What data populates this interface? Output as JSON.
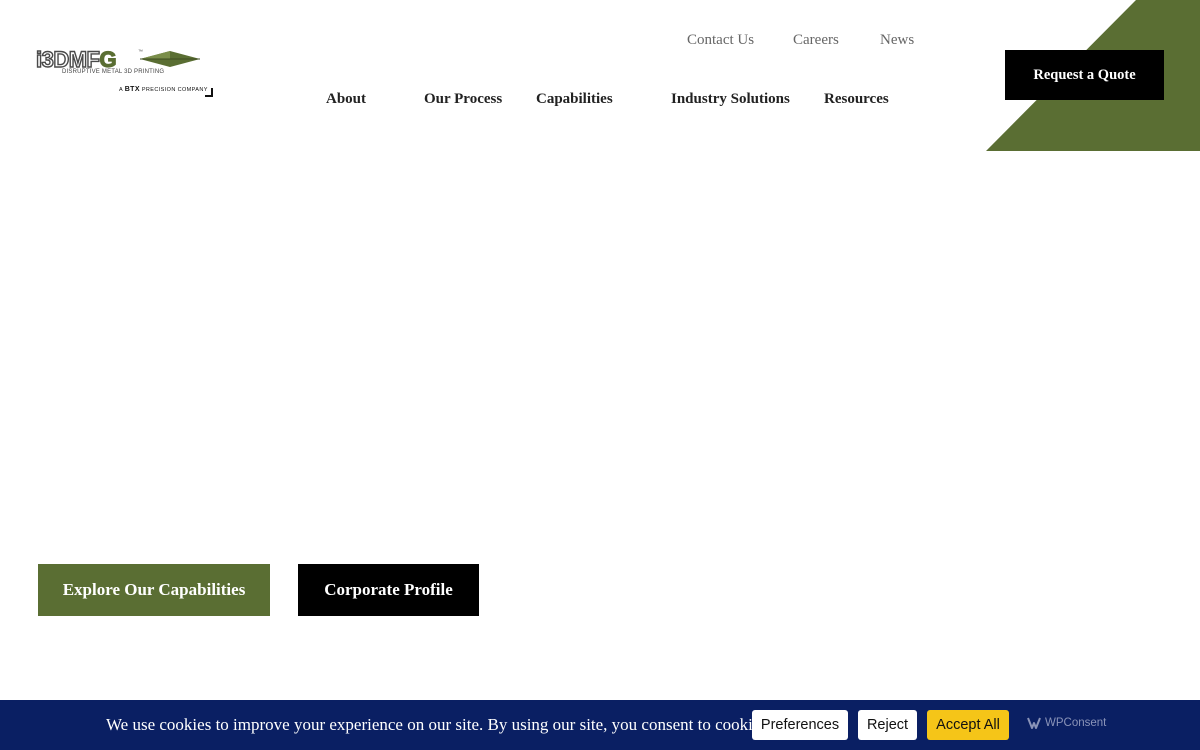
{
  "logo": {
    "wordmark_main": "i3DMF",
    "wordmark_accent": "G",
    "trademark": "™",
    "tagline": "DISRUPTIVE METAL 3D PRINTING",
    "sub_prefix": "A ",
    "sub_brand": "BTX",
    "sub_suffix": " PRECISION COMPANY"
  },
  "utility_nav": [
    {
      "label": "Contact Us"
    },
    {
      "label": "Careers"
    },
    {
      "label": "News"
    }
  ],
  "main_nav": [
    {
      "label": "About"
    },
    {
      "label": "Our Process"
    },
    {
      "label": "Capabilities"
    },
    {
      "label": "Industry Solutions"
    },
    {
      "label": "Resources"
    }
  ],
  "cta": {
    "label": "Request a Quote"
  },
  "hero": {
    "buttons": [
      {
        "label": "Explore Our Capabilities"
      },
      {
        "label": "Corporate Profile"
      }
    ]
  },
  "cookie_banner": {
    "text": "We use cookies to improve your experience on our site. By using our site, you consent to cookies.",
    "preferences_label": "Preferences",
    "reject_label": "Reject",
    "accept_label": "Accept All",
    "powered_by": "WPConsent"
  },
  "icons": [
    "logo-arrow-icon",
    "wpconsent-logo-icon"
  ],
  "colors": {
    "brand_green": "#5a6e33",
    "cta_black": "#000000",
    "cookie_bar": "#0a1f63",
    "accept_yellow": "#f5c518"
  }
}
